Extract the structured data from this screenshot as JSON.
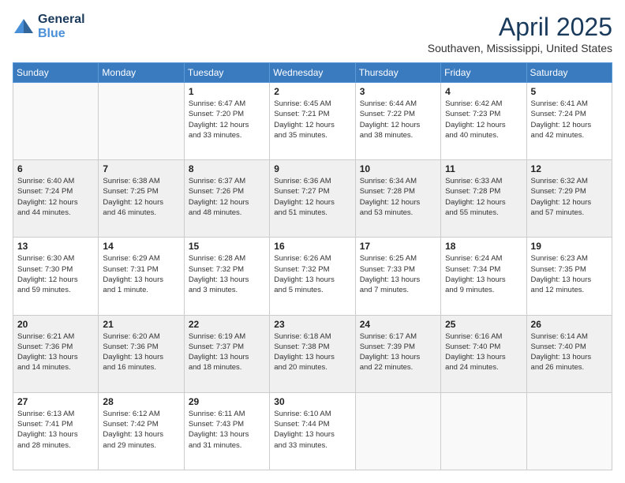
{
  "logo": {
    "line1": "General",
    "line2": "Blue"
  },
  "title": "April 2025",
  "location": "Southaven, Mississippi, United States",
  "days_of_week": [
    "Sunday",
    "Monday",
    "Tuesday",
    "Wednesday",
    "Thursday",
    "Friday",
    "Saturday"
  ],
  "weeks": [
    [
      {
        "day": "",
        "info": ""
      },
      {
        "day": "",
        "info": ""
      },
      {
        "day": "1",
        "info": "Sunrise: 6:47 AM\nSunset: 7:20 PM\nDaylight: 12 hours\nand 33 minutes."
      },
      {
        "day": "2",
        "info": "Sunrise: 6:45 AM\nSunset: 7:21 PM\nDaylight: 12 hours\nand 35 minutes."
      },
      {
        "day": "3",
        "info": "Sunrise: 6:44 AM\nSunset: 7:22 PM\nDaylight: 12 hours\nand 38 minutes."
      },
      {
        "day": "4",
        "info": "Sunrise: 6:42 AM\nSunset: 7:23 PM\nDaylight: 12 hours\nand 40 minutes."
      },
      {
        "day": "5",
        "info": "Sunrise: 6:41 AM\nSunset: 7:24 PM\nDaylight: 12 hours\nand 42 minutes."
      }
    ],
    [
      {
        "day": "6",
        "info": "Sunrise: 6:40 AM\nSunset: 7:24 PM\nDaylight: 12 hours\nand 44 minutes."
      },
      {
        "day": "7",
        "info": "Sunrise: 6:38 AM\nSunset: 7:25 PM\nDaylight: 12 hours\nand 46 minutes."
      },
      {
        "day": "8",
        "info": "Sunrise: 6:37 AM\nSunset: 7:26 PM\nDaylight: 12 hours\nand 48 minutes."
      },
      {
        "day": "9",
        "info": "Sunrise: 6:36 AM\nSunset: 7:27 PM\nDaylight: 12 hours\nand 51 minutes."
      },
      {
        "day": "10",
        "info": "Sunrise: 6:34 AM\nSunset: 7:28 PM\nDaylight: 12 hours\nand 53 minutes."
      },
      {
        "day": "11",
        "info": "Sunrise: 6:33 AM\nSunset: 7:28 PM\nDaylight: 12 hours\nand 55 minutes."
      },
      {
        "day": "12",
        "info": "Sunrise: 6:32 AM\nSunset: 7:29 PM\nDaylight: 12 hours\nand 57 minutes."
      }
    ],
    [
      {
        "day": "13",
        "info": "Sunrise: 6:30 AM\nSunset: 7:30 PM\nDaylight: 12 hours\nand 59 minutes."
      },
      {
        "day": "14",
        "info": "Sunrise: 6:29 AM\nSunset: 7:31 PM\nDaylight: 13 hours\nand 1 minute."
      },
      {
        "day": "15",
        "info": "Sunrise: 6:28 AM\nSunset: 7:32 PM\nDaylight: 13 hours\nand 3 minutes."
      },
      {
        "day": "16",
        "info": "Sunrise: 6:26 AM\nSunset: 7:32 PM\nDaylight: 13 hours\nand 5 minutes."
      },
      {
        "day": "17",
        "info": "Sunrise: 6:25 AM\nSunset: 7:33 PM\nDaylight: 13 hours\nand 7 minutes."
      },
      {
        "day": "18",
        "info": "Sunrise: 6:24 AM\nSunset: 7:34 PM\nDaylight: 13 hours\nand 9 minutes."
      },
      {
        "day": "19",
        "info": "Sunrise: 6:23 AM\nSunset: 7:35 PM\nDaylight: 13 hours\nand 12 minutes."
      }
    ],
    [
      {
        "day": "20",
        "info": "Sunrise: 6:21 AM\nSunset: 7:36 PM\nDaylight: 13 hours\nand 14 minutes."
      },
      {
        "day": "21",
        "info": "Sunrise: 6:20 AM\nSunset: 7:36 PM\nDaylight: 13 hours\nand 16 minutes."
      },
      {
        "day": "22",
        "info": "Sunrise: 6:19 AM\nSunset: 7:37 PM\nDaylight: 13 hours\nand 18 minutes."
      },
      {
        "day": "23",
        "info": "Sunrise: 6:18 AM\nSunset: 7:38 PM\nDaylight: 13 hours\nand 20 minutes."
      },
      {
        "day": "24",
        "info": "Sunrise: 6:17 AM\nSunset: 7:39 PM\nDaylight: 13 hours\nand 22 minutes."
      },
      {
        "day": "25",
        "info": "Sunrise: 6:16 AM\nSunset: 7:40 PM\nDaylight: 13 hours\nand 24 minutes."
      },
      {
        "day": "26",
        "info": "Sunrise: 6:14 AM\nSunset: 7:40 PM\nDaylight: 13 hours\nand 26 minutes."
      }
    ],
    [
      {
        "day": "27",
        "info": "Sunrise: 6:13 AM\nSunset: 7:41 PM\nDaylight: 13 hours\nand 28 minutes."
      },
      {
        "day": "28",
        "info": "Sunrise: 6:12 AM\nSunset: 7:42 PM\nDaylight: 13 hours\nand 29 minutes."
      },
      {
        "day": "29",
        "info": "Sunrise: 6:11 AM\nSunset: 7:43 PM\nDaylight: 13 hours\nand 31 minutes."
      },
      {
        "day": "30",
        "info": "Sunrise: 6:10 AM\nSunset: 7:44 PM\nDaylight: 13 hours\nand 33 minutes."
      },
      {
        "day": "",
        "info": ""
      },
      {
        "day": "",
        "info": ""
      },
      {
        "day": "",
        "info": ""
      }
    ]
  ]
}
